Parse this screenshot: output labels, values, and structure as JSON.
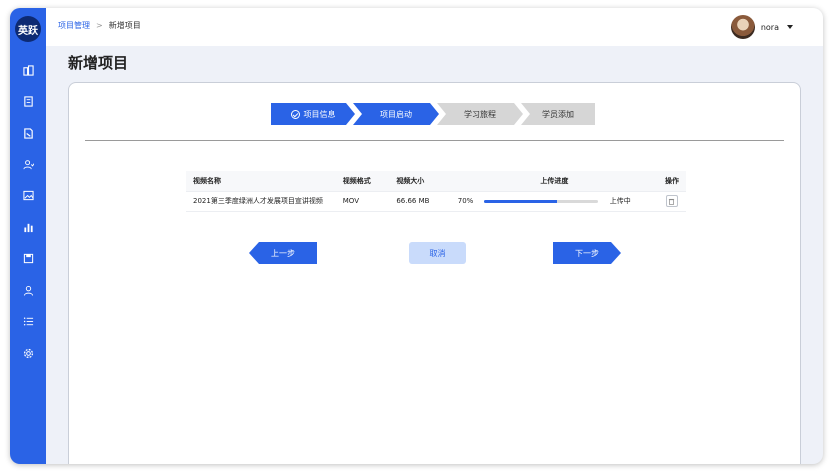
{
  "app": {
    "logo_text": "英跃"
  },
  "sidebar": {
    "items": [
      {
        "icon": "building-icon"
      },
      {
        "icon": "document-icon"
      },
      {
        "icon": "document-edit-icon"
      },
      {
        "icon": "user-group-icon"
      },
      {
        "icon": "image-icon"
      },
      {
        "icon": "bar-chart-icon"
      },
      {
        "icon": "save-icon"
      },
      {
        "icon": "user-icon"
      },
      {
        "icon": "list-icon"
      },
      {
        "icon": "gear-icon"
      }
    ]
  },
  "header": {
    "breadcrumb": {
      "parent": "项目管理",
      "separator": ">",
      "current": "新增项目"
    },
    "user": {
      "name": "nora"
    }
  },
  "page": {
    "title": "新增项目"
  },
  "steps": [
    {
      "label": "项目信息",
      "state": "done"
    },
    {
      "label": "项目启动",
      "state": "active"
    },
    {
      "label": "学习旅程",
      "state": "todo"
    },
    {
      "label": "学员添加",
      "state": "todo"
    }
  ],
  "table": {
    "headers": {
      "name": "视频名称",
      "format": "视频格式",
      "size": "视频大小",
      "progress": "上传进度",
      "operation": "操作"
    },
    "rows": [
      {
        "name": "2021第三季度绿洲人才发展项目宣讲视频",
        "format": "MOV",
        "size": "66.66 MB",
        "progress_text": "70%",
        "progress_fraction": 0.64,
        "status": "上传中"
      }
    ]
  },
  "buttons": {
    "prev": "上一步",
    "cancel": "取消",
    "next": "下一步"
  },
  "colors": {
    "accent": "#2a63e6",
    "inactive_step": "#d6d6d6",
    "cancel_bg": "#c9dbfb"
  }
}
